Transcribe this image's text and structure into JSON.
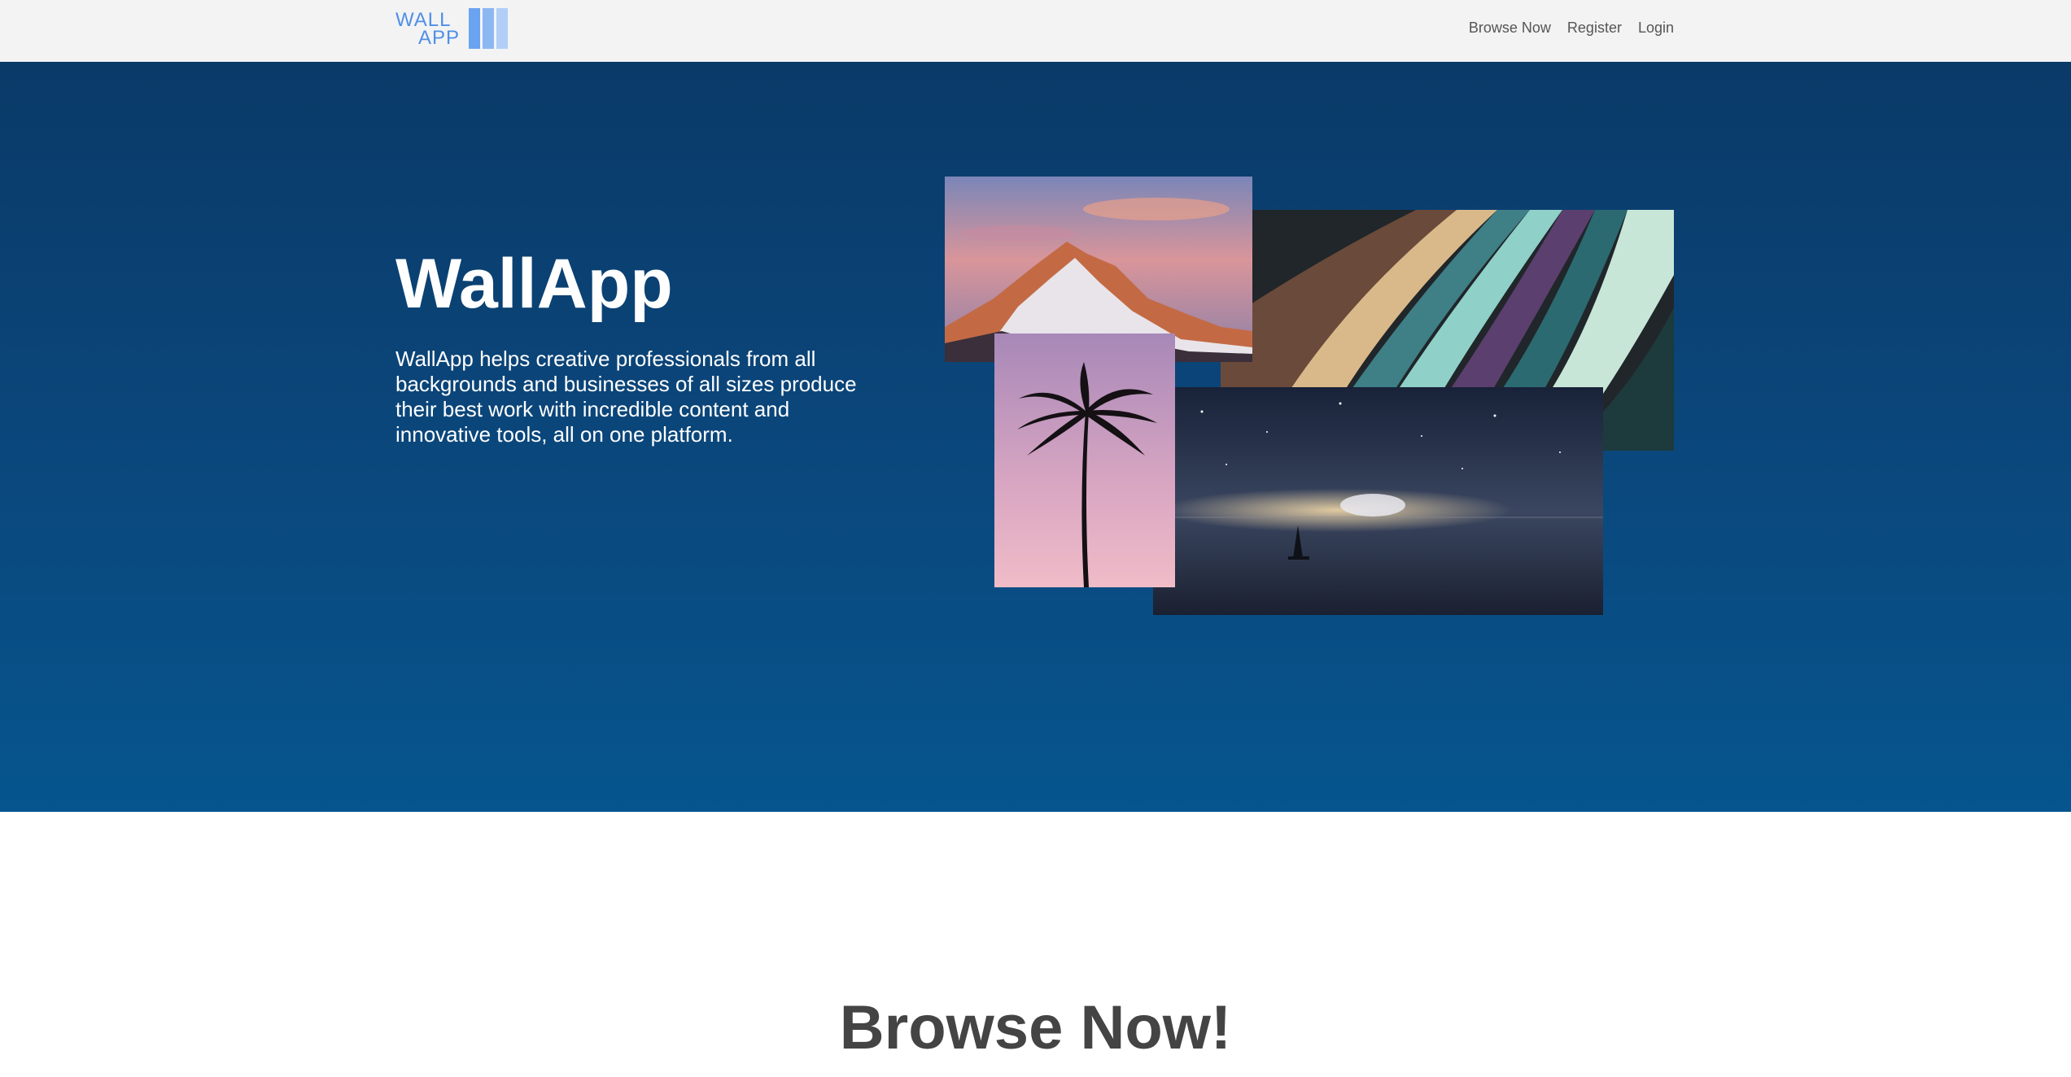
{
  "brand": {
    "line1": "WALL",
    "line2": "APP",
    "color": "#4f8fe6"
  },
  "nav": {
    "links": [
      "Browse Now",
      "Register",
      "Login"
    ]
  },
  "hero": {
    "title": "WallApp",
    "description": "WallApp helps creative professionals from all backgrounds and businesses of all sizes produce their best work with incredible content and innovative tools, all on one platform."
  },
  "section": {
    "browse_title": "Browse Now!"
  },
  "colors": {
    "hero_bg": "#0b4579",
    "nav_bg": "#f3f3f4",
    "heading": "#444444"
  }
}
